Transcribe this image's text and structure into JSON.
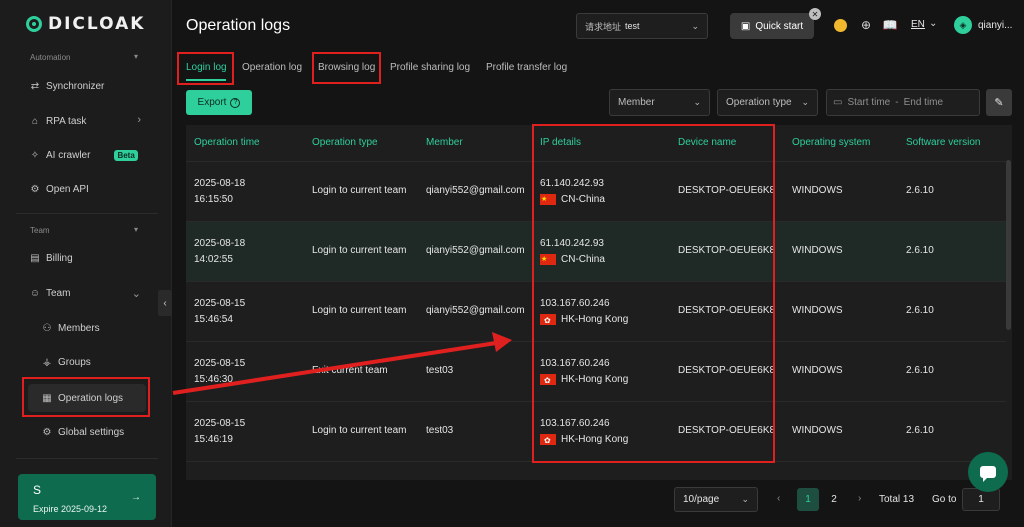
{
  "app": {
    "logo_text": "DICLOAK"
  },
  "sidebar": {
    "automation_label": "Automation",
    "automation_items": [
      {
        "label": "Synchronizer"
      },
      {
        "label": "RPA task"
      },
      {
        "label": "AI crawler",
        "badge": "Beta"
      },
      {
        "label": "Open API"
      }
    ],
    "team_label": "Team",
    "team_items": [
      {
        "label": "Billing"
      },
      {
        "label": "Team"
      },
      {
        "label": "Members"
      },
      {
        "label": "Groups"
      },
      {
        "label": "Operation logs"
      },
      {
        "label": "Global settings"
      }
    ],
    "expire_card": {
      "initial": "S",
      "text": "Expire 2025-09-12"
    }
  },
  "header": {
    "title": "Operation logs",
    "region_label": "请求地址",
    "region_value": "test",
    "quick_start": "Quick start",
    "lang": "EN",
    "username": "qianyi..."
  },
  "tabs": [
    {
      "label": "Login log",
      "active": true
    },
    {
      "label": "Operation log"
    },
    {
      "label": "Browsing log"
    },
    {
      "label": "Profile sharing log"
    },
    {
      "label": "Profile transfer log"
    }
  ],
  "toolbar": {
    "export_label": "Export",
    "member_placeholder": "Member",
    "op_type_placeholder": "Operation type",
    "start_placeholder": "Start time",
    "range_sep": "-",
    "end_placeholder": "End time"
  },
  "table": {
    "columns": [
      "Operation time",
      "Operation type",
      "Member",
      "IP details",
      "Device name",
      "Operating system",
      "Software version"
    ],
    "rows": [
      {
        "date": "2025-08-18",
        "time": "16:15:50",
        "type": "Login to current team",
        "member": "qianyi552@gmail.com",
        "ip": "61.140.242.93",
        "location": "CN-China",
        "flag": "cn",
        "device": "DESKTOP-OEUE6K8",
        "os": "WINDOWS",
        "version": "2.6.10"
      },
      {
        "date": "2025-08-18",
        "time": "14:02:55",
        "type": "Login to current team",
        "member": "qianyi552@gmail.com",
        "ip": "61.140.242.93",
        "location": "CN-China",
        "flag": "cn",
        "device": "DESKTOP-OEUE6K8",
        "os": "WINDOWS",
        "version": "2.6.10"
      },
      {
        "date": "2025-08-15",
        "time": "15:46:54",
        "type": "Login to current team",
        "member": "qianyi552@gmail.com",
        "ip": "103.167.60.246",
        "location": "HK-Hong Kong",
        "flag": "hk",
        "device": "DESKTOP-OEUE6K8",
        "os": "WINDOWS",
        "version": "2.6.10"
      },
      {
        "date": "2025-08-15",
        "time": "15:46:30",
        "type": "Exit current team",
        "member": "test03",
        "ip": "103.167.60.246",
        "location": "HK-Hong Kong",
        "flag": "hk",
        "device": "DESKTOP-OEUE6K8",
        "os": "WINDOWS",
        "version": "2.6.10"
      },
      {
        "date": "2025-08-15",
        "time": "15:46:19",
        "type": "Login to current team",
        "member": "test03",
        "ip": "103.167.60.246",
        "location": "HK-Hong Kong",
        "flag": "hk",
        "device": "DESKTOP-OEUE6K8",
        "os": "WINDOWS",
        "version": "2.6.10"
      }
    ]
  },
  "pagination": {
    "page_size": "10/page",
    "pages": [
      "1",
      "2"
    ],
    "current": "1",
    "total": "Total 13",
    "goto_label": "Go to",
    "goto_value": "1"
  },
  "colors": {
    "accent": "#2ecf9b",
    "annotation": "#e0201f",
    "background": "#141414"
  }
}
